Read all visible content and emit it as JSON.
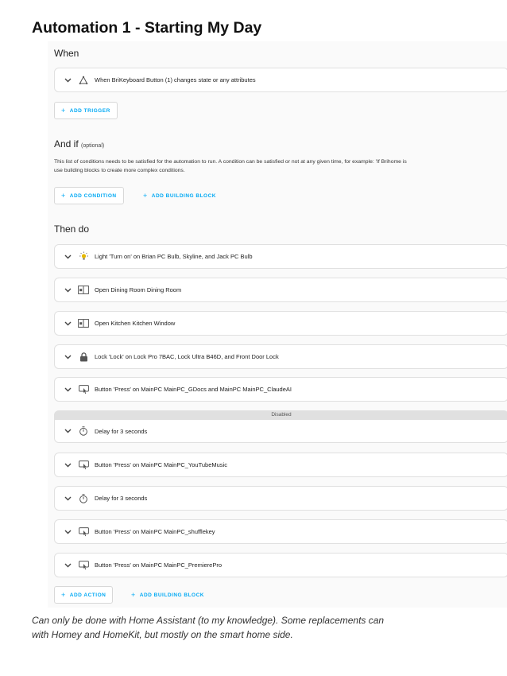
{
  "doc": {
    "title": "Automation 1 - Starting My Day",
    "caption_line1": "Can only be done with Home Assistant (to my knowledge). Some replacements can",
    "caption_line2": "with Homey and HomeKit, but mostly on the smart home side."
  },
  "when": {
    "title": "When",
    "trigger": {
      "icon": "state-trigger-icon",
      "label": "When BriKeyboard Button (1) changes state or any attributes"
    },
    "add_trigger": "ADD TRIGGER"
  },
  "and_if": {
    "title": "And if",
    "optional": "(optional)",
    "description_line1": "This list of conditions needs to be satisfied for the automation to run. A condition can be satisfied or not at any given time, for example: 'If Brihome is",
    "description_line2": "use building blocks to create more complex conditions.",
    "add_condition": "ADD CONDITION",
    "add_building_block": "ADD BUILDING BLOCK"
  },
  "then_do": {
    "title": "Then do",
    "actions": [
      {
        "icon": "lightbulb-icon",
        "label": "Light 'Turn on' on Brian PC Bulb, Skyline, and Jack PC Bulb"
      },
      {
        "icon": "window-open-icon",
        "label": "Open Dining Room Dining Room"
      },
      {
        "icon": "window-open-icon",
        "label": "Open Kitchen Kitchen Window"
      },
      {
        "icon": "lock-icon",
        "label": "Lock 'Lock' on Lock Pro 7BAC, Lock Ultra B46D, and Front Door Lock"
      },
      {
        "icon": "button-press-icon",
        "label": "Button 'Press' on MainPC MainPC_GDocs and MainPC MainPC_ClaudeAI"
      },
      {
        "icon": "timer-icon",
        "label": "Delay for 3 seconds",
        "disabled_label": "Disabled"
      },
      {
        "icon": "button-press-icon",
        "label": "Button 'Press' on MainPC MainPC_YouTubeMusic"
      },
      {
        "icon": "timer-icon",
        "label": "Delay for 3 seconds"
      },
      {
        "icon": "button-press-icon",
        "label": "Button 'Press' on MainPC MainPC_shufflekey"
      },
      {
        "icon": "button-press-icon",
        "label": "Button 'Press' on MainPC MainPC_PremierePro"
      }
    ],
    "add_action": "ADD ACTION",
    "add_building_block": "ADD BUILDING BLOCK"
  },
  "colors": {
    "accent": "#03a9f4",
    "card_border": "#e0e0e0",
    "disabled_bar": "#e0e0e0"
  }
}
